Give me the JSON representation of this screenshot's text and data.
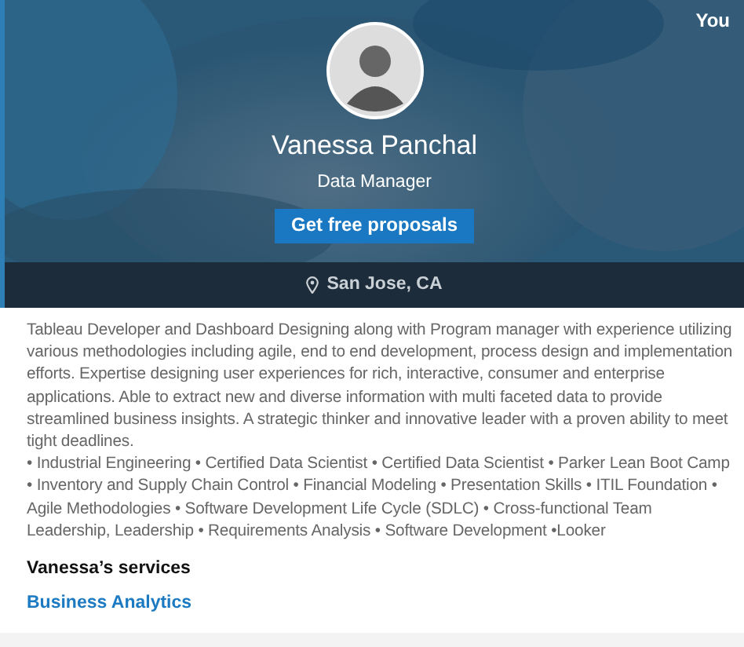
{
  "header": {
    "corner_label": "You",
    "name": "Vanessa Panchal",
    "headline": "Data Manager",
    "cta_button": "Get free proposals"
  },
  "location": "San Jose, CA",
  "about": {
    "summary": "Tableau Developer and Dashboard Designing along with Program manager with experience utilizing various methodologies including agile, end to end development, process design and implementation efforts.  Expertise designing user experiences for rich, interactive, consumer and enterprise applications.  Able to extract new and diverse information with multi faceted data to provide streamlined business insights.  A strategic thinker and innovative leader with a proven ability to meet tight deadlines.",
    "skills": "• Industrial Engineering • Certified Data Scientist • Certified Data Scientist • Parker Lean Boot Camp  • Inventory and Supply Chain Control • Financial Modeling • Presentation Skills • ITIL Foundation • Agile Methodologies • Software Development Life Cycle (SDLC) • Cross-functional Team Leadership, Leadership • Requirements Analysis • Software Development •Looker"
  },
  "services": {
    "title": "Vanessa’s services",
    "items": [
      "Business Analytics"
    ]
  }
}
